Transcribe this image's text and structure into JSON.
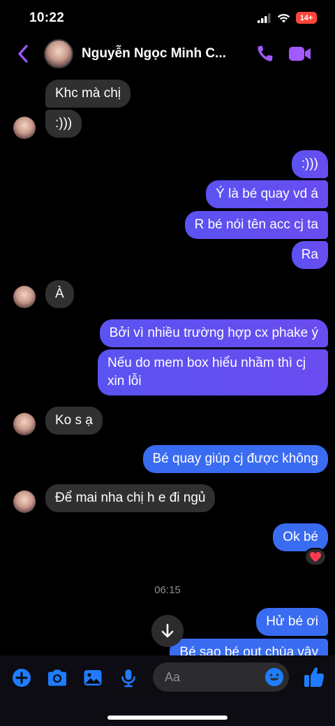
{
  "status_bar": {
    "time": "10:22",
    "battery": "14+"
  },
  "header": {
    "name": "Nguyễn Ngọc Minh C...",
    "accent_color": "#a259ff"
  },
  "messages": [
    {
      "side": "in",
      "text": "Khc mà chị"
    },
    {
      "side": "in",
      "text": ":)))"
    },
    {
      "side": "out",
      "text": ":)))"
    },
    {
      "side": "out",
      "text": "Ý là bé quay vd á"
    },
    {
      "side": "out",
      "text": "R bé nói tên acc cj ta"
    },
    {
      "side": "out",
      "text": "Ra"
    },
    {
      "side": "in",
      "text": "À"
    },
    {
      "side": "out",
      "text": "Bởi vì nhiều trường hợp cx phake ý"
    },
    {
      "side": "out",
      "text": "Nếu do mem box hiểu nhầm thì cj"
    },
    {
      "side": "out",
      "text": "xin lỗi"
    },
    {
      "side": "in",
      "text": "Ko s ạ"
    },
    {
      "side": "out",
      "text": "Bé quay giúp cj được không"
    },
    {
      "side": "in",
      "text": "Để mai nha chị h e đi ngủ"
    },
    {
      "side": "out",
      "text": "Ok bé"
    },
    {
      "side": "out",
      "text": "Hử bé ơi"
    },
    {
      "side": "out",
      "text": "Bé sao bé out chùa vậy"
    }
  ],
  "reaction": "heart",
  "timestamp": "06:15",
  "composer": {
    "placeholder": "Aa"
  },
  "icons": [
    "back-icon",
    "phone-icon",
    "video-icon",
    "plus-icon",
    "camera-icon",
    "image-icon",
    "mic-icon",
    "emoji-icon",
    "like-icon",
    "arrow-down-icon"
  ]
}
